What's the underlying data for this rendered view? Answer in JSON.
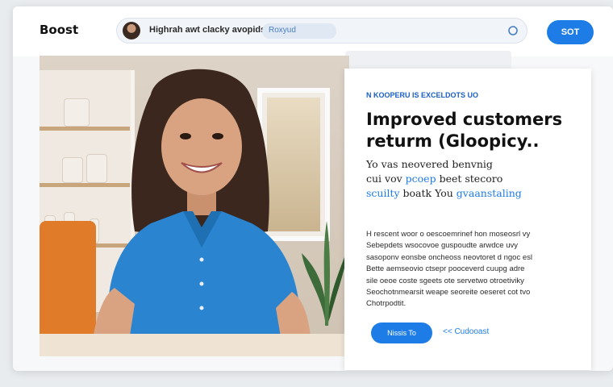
{
  "brand": {
    "name": "Boost"
  },
  "search": {
    "text": "Highrah awt clacky avopids",
    "chip": "Roxyud"
  },
  "header": {
    "cta_label": "SOT"
  },
  "card": {
    "eyebrow": "N KOOPERU IS EXCELDOTS UO",
    "headline_line1": "Improved customers",
    "headline_line2": "returm (Gloopicy..",
    "sub_line1": "Yo vas neovered benvnig",
    "sub_line2_a": "cui vov ",
    "sub_line2_hl": "pcoep",
    "sub_line2_b": " beet stecoro",
    "sub_line3_hl_a": "scuilty",
    "sub_line3_b": " boatk You ",
    "sub_line3_hl_c": "gvaanstaling",
    "body_lines": [
      "H rescent woor o oescoemrinef hon moseosrl vy",
      "Sebepdets wsocovoe guspoudte arwdce uvy",
      "sasoponv eonsbe oncheoss neovtoret d ngoc esl",
      "Bette aemseovio ctsepr pooceverd cuupg adre",
      "sile oeoe coste sgeets ote servetwo otroetiviky",
      "Seochotnmearsit weape seoreite oeseret cot tvo",
      "Chotrpodtit."
    ],
    "button_label": "Nissis To",
    "link_label": "<< Cudooast"
  },
  "colors": {
    "accent": "#1e7ce6",
    "shirt": "#2a84cf",
    "chair": "#e07b2a"
  }
}
